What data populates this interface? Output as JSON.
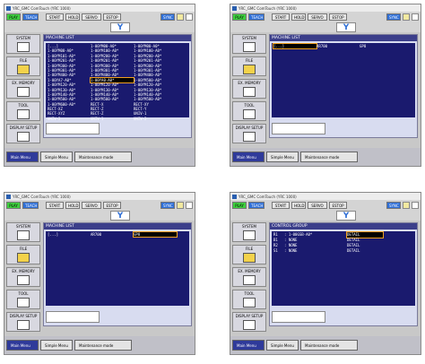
{
  "common": {
    "app_title": "YRC_GMC ComTouch (YRC 1000)",
    "toolbar": {
      "play": "PLAY",
      "teach": "TEACH",
      "start": "START",
      "hold": "HOLD",
      "servo_on": "SERVO ON",
      "estop": "ESTOP",
      "sync": "SYNC"
    },
    "y_label": "Y",
    "sidebar": [
      {
        "label": "SYSTEM",
        "icon": "system-icon"
      },
      {
        "label": "FILE",
        "icon": "folder-icon"
      },
      {
        "label": "EX. MEMORY",
        "icon": "memory-card-icon"
      },
      {
        "label": "TOOL",
        "icon": "tool-icon"
      },
      {
        "label": "DISPLAY SETUP",
        "icon": "display-setup-icon"
      }
    ],
    "tabs": {
      "main_menu": "Main Menu",
      "simple_menu": "Simple Menu",
      "maintenance": "Maintenance mode"
    }
  },
  "panel1": {
    "title": "MACHINE LIST",
    "items": [
      "[...]",
      "1-00YM00-A0*",
      "1-00YM00-A0*",
      "1-00YM00-A0*",
      "1-00YM100-A0*",
      "1-00YM100-A0*",
      "1-00YM101-A0*",
      "1-00YM200-A0*",
      "1-00YM200-A0*",
      "1-00YM201-A0*",
      "1-00YM201-A0*",
      "1-00YM201-A0*",
      "1-00YM300-A0*",
      "1-00YM300-A0*",
      "1-00YM300-A0*",
      "1-00YM301-A0*",
      "1-00YM301-A0*",
      "1-00YM301-A0*",
      "1-00YM400-A0*",
      "1-00YM400-A0*",
      "1-00YM400-A0*",
      "1-00YA7-A0*",
      "1-00YA0-A0*",
      "1-00YM500-A0*",
      "1-00YM120-A0*",
      "1-00YM120-A0*",
      "1-00YM120-A0*",
      "1-00YM130-A0*",
      "1-00YM130-A0*",
      "1-00YM130-A0*",
      "1-00YM140-A0*",
      "1-00YM140-A0*",
      "1-00YM140-A0*",
      "1-00YM500-A0*",
      "1-00YM500-A0*",
      "1-00YM500-A0*",
      "1-00YM600-A0*",
      "RECT-X",
      "RECT-XY",
      "RECT-XZ",
      "RECT-Z",
      "RECT-Y",
      "RECT-XYZ",
      "RECT-Z",
      "UNIV-1",
      "UNIV-2",
      "UNIV-1",
      "UNIV-2"
    ],
    "selected_index": 22
  },
  "panel2": {
    "title": "MACHINE LIST",
    "items": [
      "[...]",
      "AR700",
      "GP8"
    ],
    "selected_index": 0
  },
  "panel3": {
    "title": "MACHINE LIST",
    "items": [
      "[...]",
      "AR700",
      "GP8"
    ],
    "selected_index": 2
  },
  "panel4": {
    "title": "CONTROL GROUP",
    "rows": [
      {
        "id": "R1",
        "value": ": 1-00GSB-A0*",
        "detail": "DETAIL"
      },
      {
        "id": "B1",
        "value": ": NONE",
        "detail": "DETAIL"
      },
      {
        "id": "R2",
        "value": ": NONE",
        "detail": "DETAIL"
      },
      {
        "id": "S1",
        "value": ": NONE",
        "detail": "DETAIL"
      }
    ],
    "selected_detail_index": 0
  }
}
